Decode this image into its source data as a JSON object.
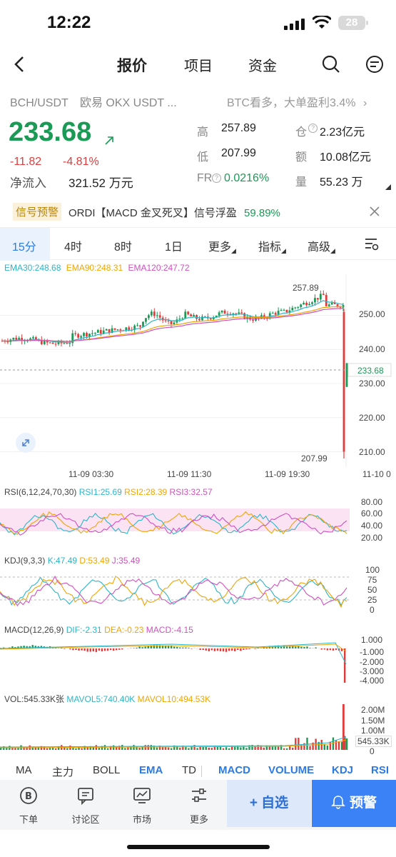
{
  "status_bar": {
    "time": "12:22",
    "battery": "28"
  },
  "nav": {
    "tabs": [
      "报价",
      "项目",
      "资金"
    ]
  },
  "header": {
    "pair": "BCH/USDT",
    "exchange": "欧易 OKX USDT ...",
    "news": "BTC看多，大单盈利3.4%",
    "price": "233.68",
    "change_abs": "-11.82",
    "change_pct": "-4.81%",
    "net_inflow_label": "净流入",
    "net_inflow_value": "321.52 万元",
    "high_label": "高",
    "high": "257.89",
    "low_label": "低",
    "low": "207.99",
    "fr_label": "FR",
    "fr": "0.0216%",
    "oi_label": "仓",
    "oi": "2.23亿元",
    "turnover_label": "额",
    "turnover": "10.08亿元",
    "volume_label": "量",
    "volume": "55.23 万"
  },
  "signal": {
    "badge": "信号预警",
    "text": "ORDI【MACD 金叉死叉】信号浮盈",
    "pct": "59.89%"
  },
  "timeframes": [
    "15分",
    "4时",
    "8时",
    "1日",
    "更多",
    "指标",
    "高级"
  ],
  "chart": {
    "ema_legend": {
      "ema30": "EMA30:248.68",
      "ema90": "EMA90:248.31",
      "ema120": "EMA120:247.72"
    },
    "price_axis": [
      "250.00",
      "240.00",
      "230.00",
      "220.00",
      "210.00"
    ],
    "current_price_tag": "233.68",
    "high_marker": "257.89",
    "low_marker": "207.99",
    "time_axis": [
      "11-09 03:30",
      "11-09 11:30",
      "11-09 19:30",
      "11-10 0"
    ],
    "colors": {
      "up": "#1a9a55",
      "down": "#e03c3c",
      "ema30": "#2bb6c9",
      "ema90": "#f0a500",
      "ema120": "#d04fbf"
    }
  },
  "rsi": {
    "title": "RSI(6,12,24,70,30)",
    "rsi1": "RSI1:25.69",
    "rsi2": "RSI2:28.39",
    "rsi3": "RSI3:32.57",
    "axis": [
      "80.00",
      "60.00",
      "40.00",
      "20.00"
    ]
  },
  "kdj": {
    "title": "KDJ(9,3,3)",
    "k": "K:47.49",
    "d": "D:53.49",
    "j": "J:35.49",
    "axis": [
      "100",
      "75",
      "50",
      "25",
      "0"
    ]
  },
  "macd": {
    "title": "MACD(12,26,9)",
    "dif": "DIF:-2.31",
    "dea": "DEA:-0.23",
    "macd": "MACD:-4.15",
    "axis": [
      "1.000",
      "-1.000",
      "-2.000",
      "-3.000",
      "-4.000"
    ]
  },
  "vol": {
    "title": "VOL:545.33K张",
    "mavol5": "MAVOL5:740.40K",
    "mavol10": "MAVOL10:494.53K",
    "axis": [
      "2.00M",
      "1.50M",
      "1.00M",
      "545.33K",
      "0"
    ]
  },
  "indicator_tabs": [
    "MA",
    "主力",
    "BOLL",
    "EMA",
    "TD",
    "MACD",
    "VOLUME",
    "KDJ",
    "RSI"
  ],
  "bottom_nav": {
    "items": [
      "下单",
      "讨论区",
      "市场",
      "更多"
    ],
    "favorite": "+ 自选",
    "alert": "预警"
  }
}
